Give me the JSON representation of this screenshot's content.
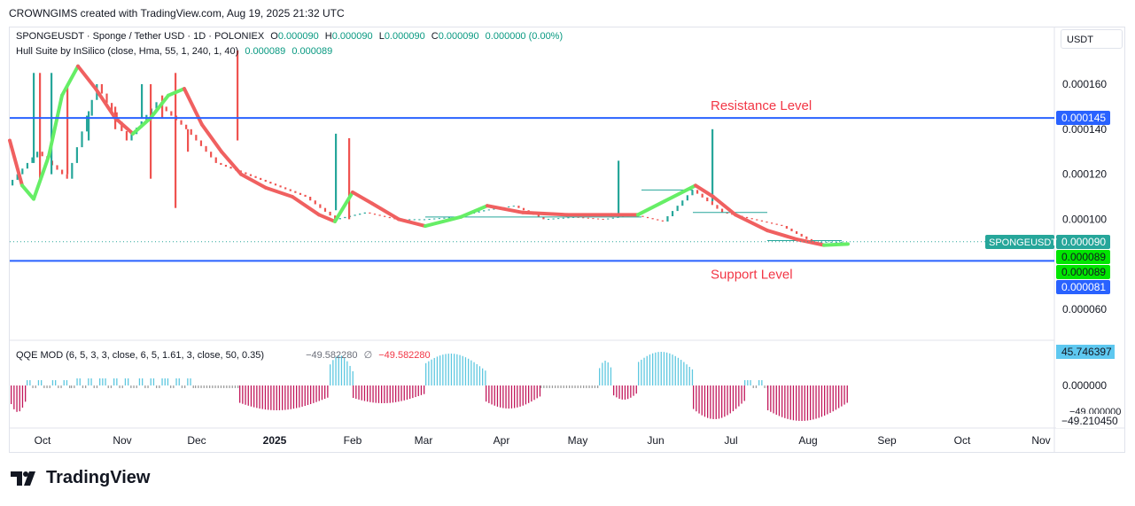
{
  "header": {
    "attribution": "CROWNGIMS created with TradingView.com, Aug 19, 2025 21:32 UTC"
  },
  "legend": {
    "symbol": "SPONGEUSDT · Sponge / Tether USD · 1D · POLONIEX",
    "o_label": "O",
    "o_value": "0.000090",
    "h_label": "H",
    "h_value": "0.000090",
    "l_label": "L",
    "l_value": "0.000090",
    "c_label": "C",
    "c_value": "0.000090",
    "change": "0.000000 (0.00%)",
    "hull_title": "Hull Suite by InSilico (close, Hma, 55, 1, 240, 1, 40)",
    "hull_v1": "0.000089",
    "hull_v2": "0.000089",
    "qqe_title": "QQE MOD (6, 5, 3, 3, close, 6, 5, 1.61, 3, close, 50, 0.35)",
    "qqe_v1": "−49.582280",
    "qqe_sym": "∅",
    "qqe_v2": "−49.582280"
  },
  "currency_button": "USDT",
  "logo_text": "TradingView",
  "colors": {
    "up": "#26a69a",
    "down": "#ef5350",
    "hull_up": "#66ee66",
    "hull_down": "#f06060",
    "level": "#2962ff",
    "annotation": "#f23645",
    "qqe_pos": "#5ec8e0",
    "qqe_neg": "#c2185b",
    "qqe_flat": "#9e9e9e"
  },
  "chart_data": [
    {
      "type": "candlestick",
      "title": "SPONGEUSDT · Sponge / Tether USD · 1D · POLONIEX",
      "ylim": [
        4e-05,
        0.00018
      ],
      "y_ticks": [
        "0.000160",
        "0.000140",
        "0.000120",
        "0.000100",
        "0.000060"
      ],
      "x_labels": [
        "Oct",
        "Nov",
        "Dec",
        "2025",
        "Feb",
        "Mar",
        "Apr",
        "May",
        "Jun",
        "Jul",
        "Aug",
        "Sep",
        "Oct",
        "Nov"
      ],
      "ohlc_summary": {
        "open": 9e-05,
        "high": 9e-05,
        "low": 9e-05,
        "close": 9e-05
      },
      "price_labels": [
        {
          "text": "SPONGEUSDT",
          "value": "0.000090",
          "y": 9e-05
        },
        {
          "text": "",
          "value": "0.000089",
          "y": 8.88e-05
        },
        {
          "text": "",
          "value": "0.000089",
          "y": 8.8e-05
        },
        {
          "text": "",
          "value": "0.000081",
          "y": 8.1e-05
        },
        {
          "text": "",
          "value": "0.000145",
          "y": 0.000145
        }
      ],
      "levels": [
        {
          "name": "Resistance Level",
          "value": 0.000145
        },
        {
          "name": "Support Level",
          "value": 8.15e-05
        }
      ],
      "hull_values": [
        "0.000089",
        "0.000089"
      ],
      "series": [
        {
          "name": "SPONGEUSDT",
          "approx_close": [
            0.000115,
            0.00013,
            0.000118,
            0.00016,
            0.000135,
            0.000152,
            0.00014,
            0.000125,
            0.00012,
            0.000115,
            0.00011,
            0.0001,
            0.000103,
            0.0001,
            0.0001,
            0.000101,
            0.000104,
            0.000106,
            0.0001,
            0.000101,
            0.0001,
            0.000102,
            9.9e-05,
            0.000113,
            0.000103,
            0.0001,
            9.7e-05,
            9e-05,
            9e-05
          ]
        }
      ]
    },
    {
      "type": "histogram",
      "title": "QQE MOD (6, 5, 3, 3, close, 6, 5, 1.61, 3, close, 50, 0.35)",
      "y_ticks": [
        "0.000000",
        "−49.000000"
      ],
      "price_labels": [
        "45.746397",
        "−49.210450"
      ],
      "values": [
        "−49.582280",
        "−49.582280"
      ]
    }
  ]
}
